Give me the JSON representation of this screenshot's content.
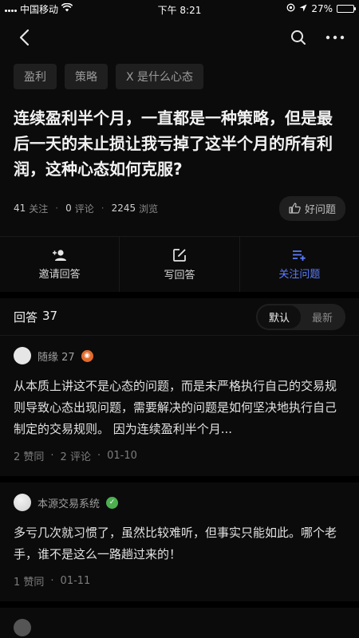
{
  "status_bar": {
    "carrier": "中国移动",
    "time": "下午 8:21",
    "battery": "27%",
    "battery_level": 0.27
  },
  "nav": {
    "back": "back",
    "search": "search",
    "more": "more"
  },
  "tags": [
    "盈利",
    "策略",
    "X 是什么心态"
  ],
  "question": {
    "title": "连续盈利半个月，一直都是一种策略，但是最后一天的未止损让我亏掉了这半个月的所有利润，这种心态如何克服?",
    "followers_count": "41",
    "followers_label": "关注",
    "comments_count": "0",
    "comments_label": "评论",
    "views_count": "2245",
    "views_label": "浏览",
    "good_question_label": "好问题"
  },
  "actions": [
    {
      "label": "邀请回答"
    },
    {
      "label": "写回答"
    },
    {
      "label": "关注问题"
    }
  ],
  "answers_header": {
    "title": "回答",
    "count": "37",
    "sort_default": "默认",
    "sort_latest": "最新"
  },
  "answers": [
    {
      "author": "随缘 27",
      "body": "从本质上讲这不是心态的问题，而是未严格执行自己的交易规则导致心态出现问题，需要解决的问题是如何坚决地执行自己制定的交易规则。 因为连续盈利半个月...",
      "likes": "2 赞同",
      "comments": "2 评论",
      "date": "01-10"
    },
    {
      "author": "本源交易系统",
      "body": "多亏几次就习惯了，虽然比较难听，但事实只能如此。哪个老手，谁不是这么一路趟过来的！",
      "likes": "1 赞同",
      "date": "01-11"
    }
  ],
  "colors": {
    "accent": "#5b7cff",
    "background": "#0b0b0b"
  }
}
